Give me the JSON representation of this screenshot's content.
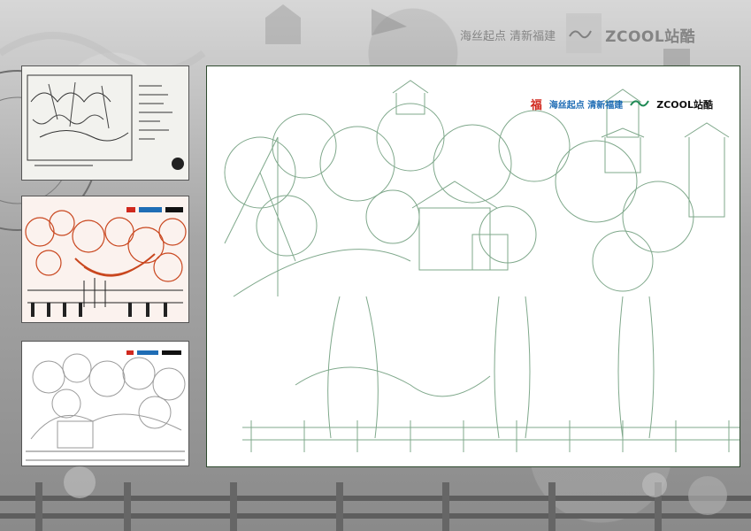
{
  "header": {
    "logo_text": "ZCOOL站酷",
    "slogan": "海丝起点 清新福建"
  },
  "main": {
    "fu_char": "福",
    "slogan": "海丝起点 清新福建",
    "logo_text": "ZCOOL站酷"
  },
  "thumbs": [
    {
      "name": "pencil-sketch"
    },
    {
      "name": "color-sketch"
    },
    {
      "name": "lineart-draft"
    }
  ],
  "colors": {
    "line_green": "#6c9a7a",
    "sketch_red": "#c9471f",
    "frame": "#2f4a2f"
  }
}
